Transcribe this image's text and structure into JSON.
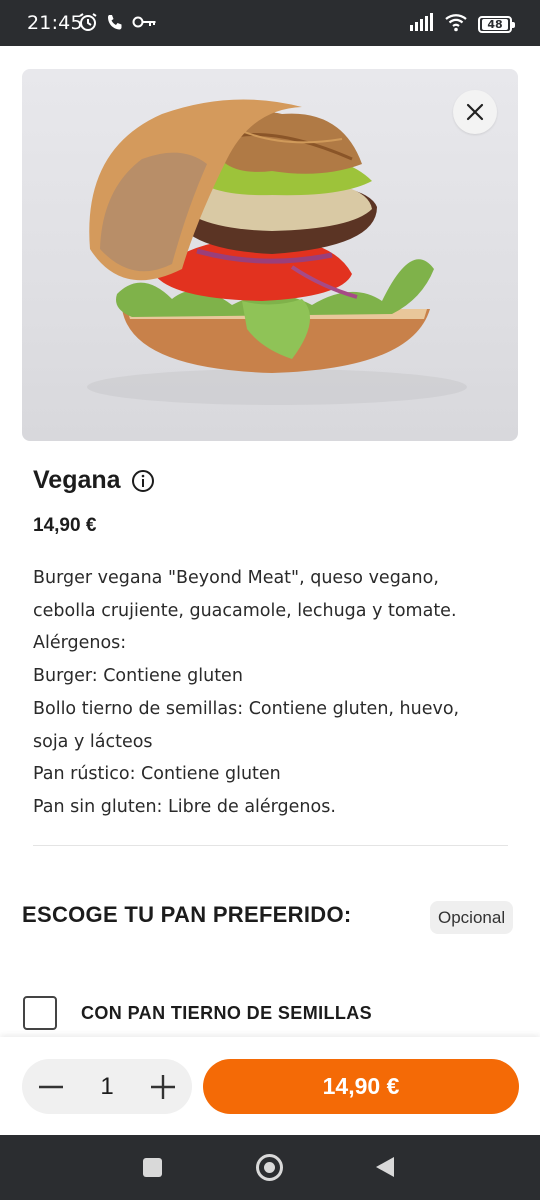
{
  "status_bar": {
    "time": "21:45",
    "battery": "48",
    "left_icons": [
      "alarm-icon",
      "phone-icon",
      "key-icon"
    ],
    "right_icons": [
      "signal-icon",
      "wifi-icon",
      "battery-icon"
    ]
  },
  "product": {
    "image_alt": "burger-photo",
    "title": "Vegana",
    "price": "14,90 €",
    "description_lines": [
      "Burger vegana \"Beyond Meat\", queso vegano,",
      "cebolla crujiente, guacamole, lechuga y tomate.",
      "Alérgenos:",
      "Burger: Contiene gluten",
      "Bollo tierno de semillas: Contiene gluten, huevo,",
      "soja y lácteos",
      "Pan rústico: Contiene gluten",
      "Pan sin gluten: Libre de alérgenos."
    ]
  },
  "section": {
    "title": "ESCOGE TU PAN PREFERIDO:",
    "badge": "Opcional",
    "options": [
      {
        "label": "CON PAN TIERNO DE SEMILLAS",
        "checked": false
      }
    ]
  },
  "cart": {
    "quantity": "1",
    "add_button": "14,90 €"
  },
  "colors": {
    "accent": "#f46a06",
    "system_bar": "#2b2d30"
  }
}
